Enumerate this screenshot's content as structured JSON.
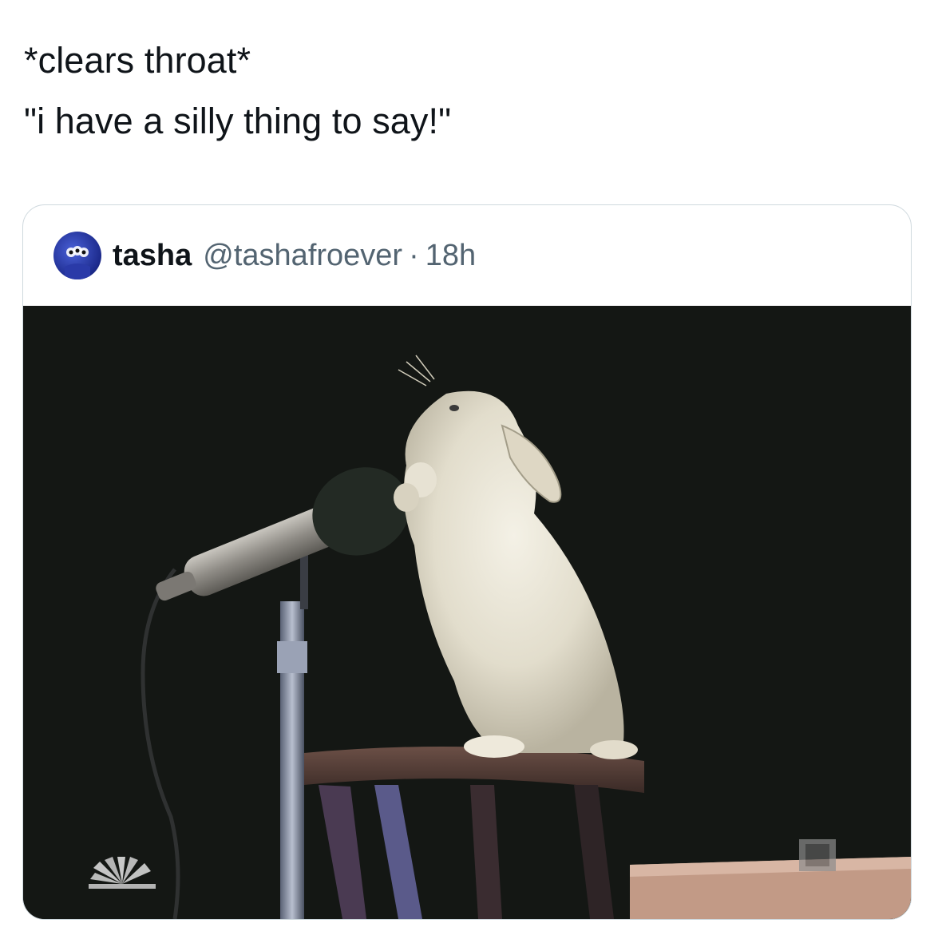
{
  "tweet": {
    "line1": "*clears throat*",
    "line2": "\"i have a silly thing to say!\""
  },
  "quote": {
    "author_name": "tasha",
    "author_handle": "@tashafroever",
    "separator": "·",
    "timestamp": "18h",
    "avatar_icon": "avatar-image",
    "media_icon": "bunny-at-microphone-image"
  },
  "colors": {
    "text": "#0f1419",
    "secondary": "#536471",
    "border": "#cfd9de",
    "stage": "#141714"
  }
}
